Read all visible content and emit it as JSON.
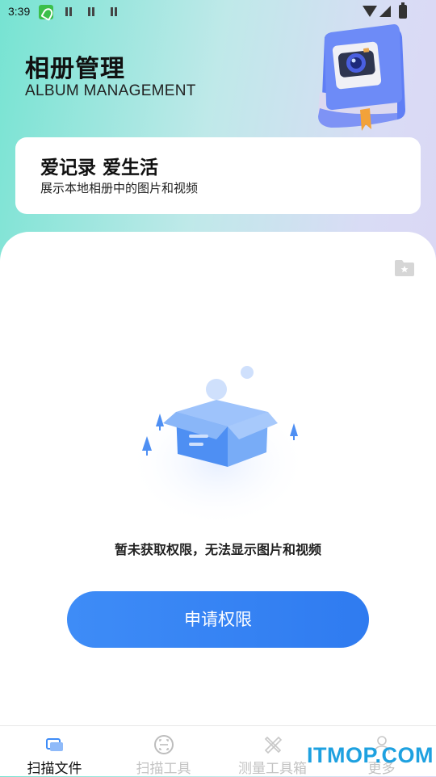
{
  "status_bar": {
    "time": "3:39"
  },
  "header": {
    "title_cn": "相册管理",
    "title_en": "ALBUM MANAGEMENT"
  },
  "card": {
    "title": "爱记录 爱生活",
    "subtitle": "展示本地相册中的图片和视频"
  },
  "empty_state": {
    "message": "暂未获取权限，无法显示图片和视频",
    "button_label": "申请权限"
  },
  "bottom_nav": {
    "items": [
      {
        "label": "扫描文件",
        "icon": "scan-file-icon",
        "active": true
      },
      {
        "label": "扫描工具",
        "icon": "scan-tool-icon",
        "active": false
      },
      {
        "label": "测量工具箱",
        "icon": "measure-tool-icon",
        "active": false
      },
      {
        "label": "更多",
        "icon": "person-icon",
        "active": false
      }
    ]
  },
  "watermark": "ITMOP.COM",
  "colors": {
    "accent": "#3e8cf7",
    "active_nav": "#111111",
    "inactive_nav": "#c3c3c3"
  }
}
